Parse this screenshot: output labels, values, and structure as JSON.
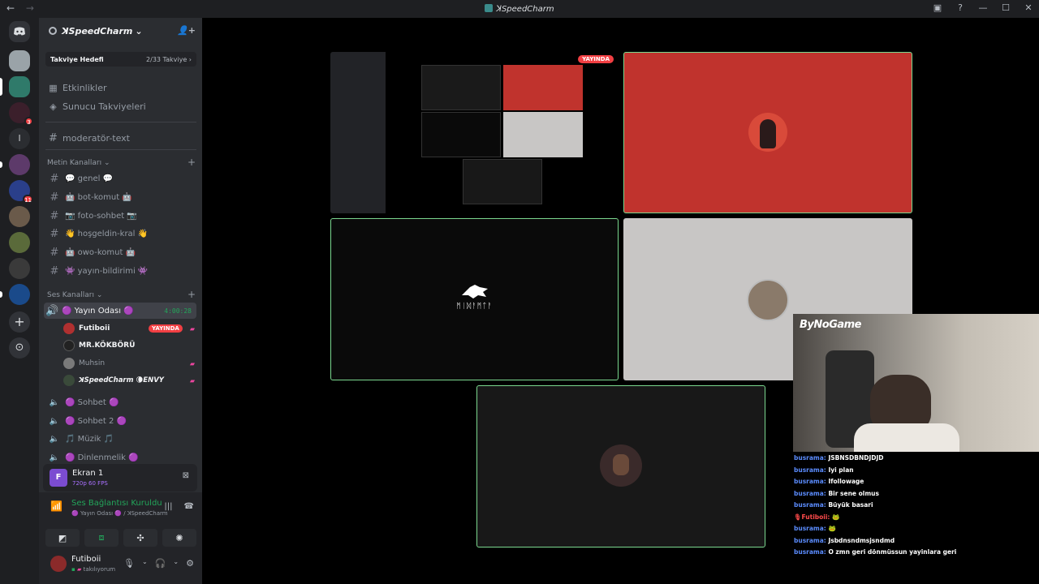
{
  "window": {
    "title": "ꓘSpeedCharm",
    "nav_back": "←",
    "nav_forward": "→",
    "controls": [
      "▣",
      "?",
      "—",
      "☐",
      "✕"
    ]
  },
  "servers": {
    "badges": [
      "3",
      "11"
    ],
    "add_label": "+",
    "explore_label": "⊙"
  },
  "guild": {
    "name": "ꓘSpeedCharm",
    "chevron": "⌄",
    "boost_label": "Takviye Hedefi",
    "boost_progress": "2/33 Takviye",
    "boost_arrow": "›",
    "boost_current": 2,
    "boost_goal": 33
  },
  "menu": {
    "events": "Etkinlikler",
    "boosts": "Sunucu Takviyeleri",
    "pinned_channel": "moderatör-text"
  },
  "text_category": {
    "label": "Metin Kanalları ⌄",
    "channels": [
      "💬 genel 💬",
      "🤖 bot-komut 🤖",
      "📷 foto-sohbet 📷",
      "👋 hoşgeldin-kral 👋",
      "🤖 owo-komut 🤖",
      "👾 yayın-bildirimi 👾"
    ]
  },
  "voice_category": {
    "label": "Ses Kanalları ⌄",
    "active_channel": "🟣 Yayın Odası 🟣",
    "timer": "4:00:28",
    "users": [
      {
        "name": "Futiboii",
        "badge": "YAYINDA",
        "color": "#b03030"
      },
      {
        "name": "MR.KÖKBÖRÜ",
        "badge": "",
        "color": "#222222"
      },
      {
        "name": "Muhsin",
        "badge": "",
        "color": "#7a7a7a"
      },
      {
        "name": "ꓘSpeedCharm 🌘ENVY",
        "badge": "",
        "color": "#3a4a3a"
      }
    ],
    "channels": [
      "🟣 Sohbet 🟣",
      "🟣 Sohbet 2 🟣",
      "🎵 Müzik 🎵",
      "🟣 Dinlenmelik 🟣"
    ]
  },
  "screen_share": {
    "icon_letter": "F",
    "title": "Ekran 1",
    "quality": "720p 60 FPS"
  },
  "voice_panel": {
    "status": "Ses Bağlantısı Kuruldu",
    "channel": "🟣 Yayın Odası 🟣 / ꓘSpeedCharm"
  },
  "user": {
    "name": "Futiboii",
    "status": "takılıyorum"
  },
  "stage": {
    "live_badge": "YAYINDA",
    "wolf_text": "ᛗᛁᛞᚨᛗᛏᚨ"
  },
  "stream_overlay": {
    "logo": "ByNoGame",
    "chat": [
      {
        "user": "busrama:",
        "text": "JSBNSDBNDJDJD",
        "red": false
      },
      {
        "user": "busrama:",
        "text": "Iyi plan",
        "red": false
      },
      {
        "user": "busrama:",
        "text": "Ifollowage",
        "red": false
      },
      {
        "user": "busrama:",
        "text": "Bir sene olmus",
        "red": false
      },
      {
        "user": "busrama:",
        "text": "Büyük basari",
        "red": false
      },
      {
        "user": "🎙Futiboii:",
        "text": "🐸",
        "red": true
      },
      {
        "user": "busrama:",
        "text": "🐸",
        "red": false
      },
      {
        "user": "busrama:",
        "text": "Jsbdnsndmsjsndmd",
        "red": false
      },
      {
        "user": "busrama:",
        "text": "O zmn geri dönmüssun yayinlara geri",
        "red": false
      }
    ]
  }
}
